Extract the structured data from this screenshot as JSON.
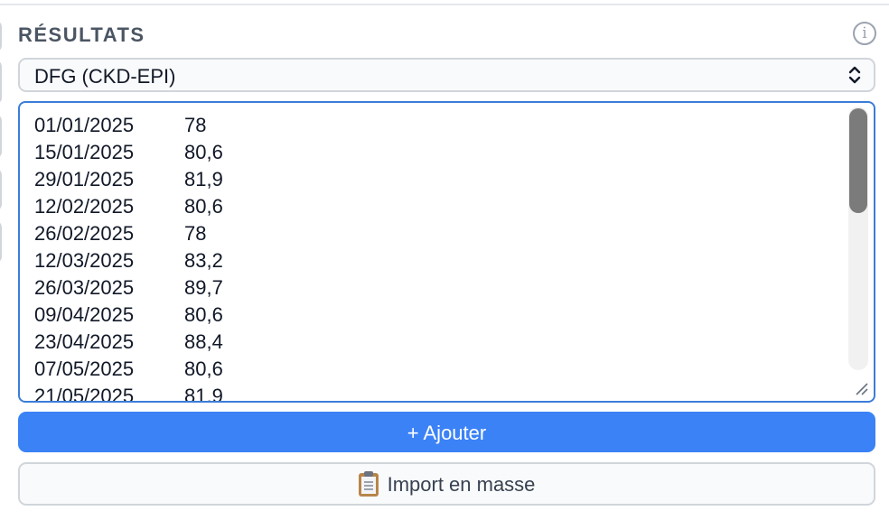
{
  "section": {
    "title": "RÉSULTATS",
    "info_icon": "info-icon"
  },
  "select": {
    "value": "DFG (CKD-EPI)"
  },
  "results": [
    {
      "date": "01/01/2025",
      "value": "78"
    },
    {
      "date": "15/01/2025",
      "value": "80,6"
    },
    {
      "date": "29/01/2025",
      "value": "81,9"
    },
    {
      "date": "12/02/2025",
      "value": "80,6"
    },
    {
      "date": "26/02/2025",
      "value": "78"
    },
    {
      "date": "12/03/2025",
      "value": "83,2"
    },
    {
      "date": "26/03/2025",
      "value": "89,7"
    },
    {
      "date": "09/04/2025",
      "value": "80,6"
    },
    {
      "date": "23/04/2025",
      "value": "88,4"
    },
    {
      "date": "07/05/2025",
      "value": "80,6"
    },
    {
      "date": "21/05/2025",
      "value": "81,9"
    }
  ],
  "buttons": {
    "add_label": "+ Ajouter",
    "import_label": "Import en masse",
    "import_icon": "clipboard-icon"
  },
  "colors": {
    "accent": "#3b82f6",
    "focus_border": "#3b7dd8",
    "title_text": "#4b5563"
  }
}
